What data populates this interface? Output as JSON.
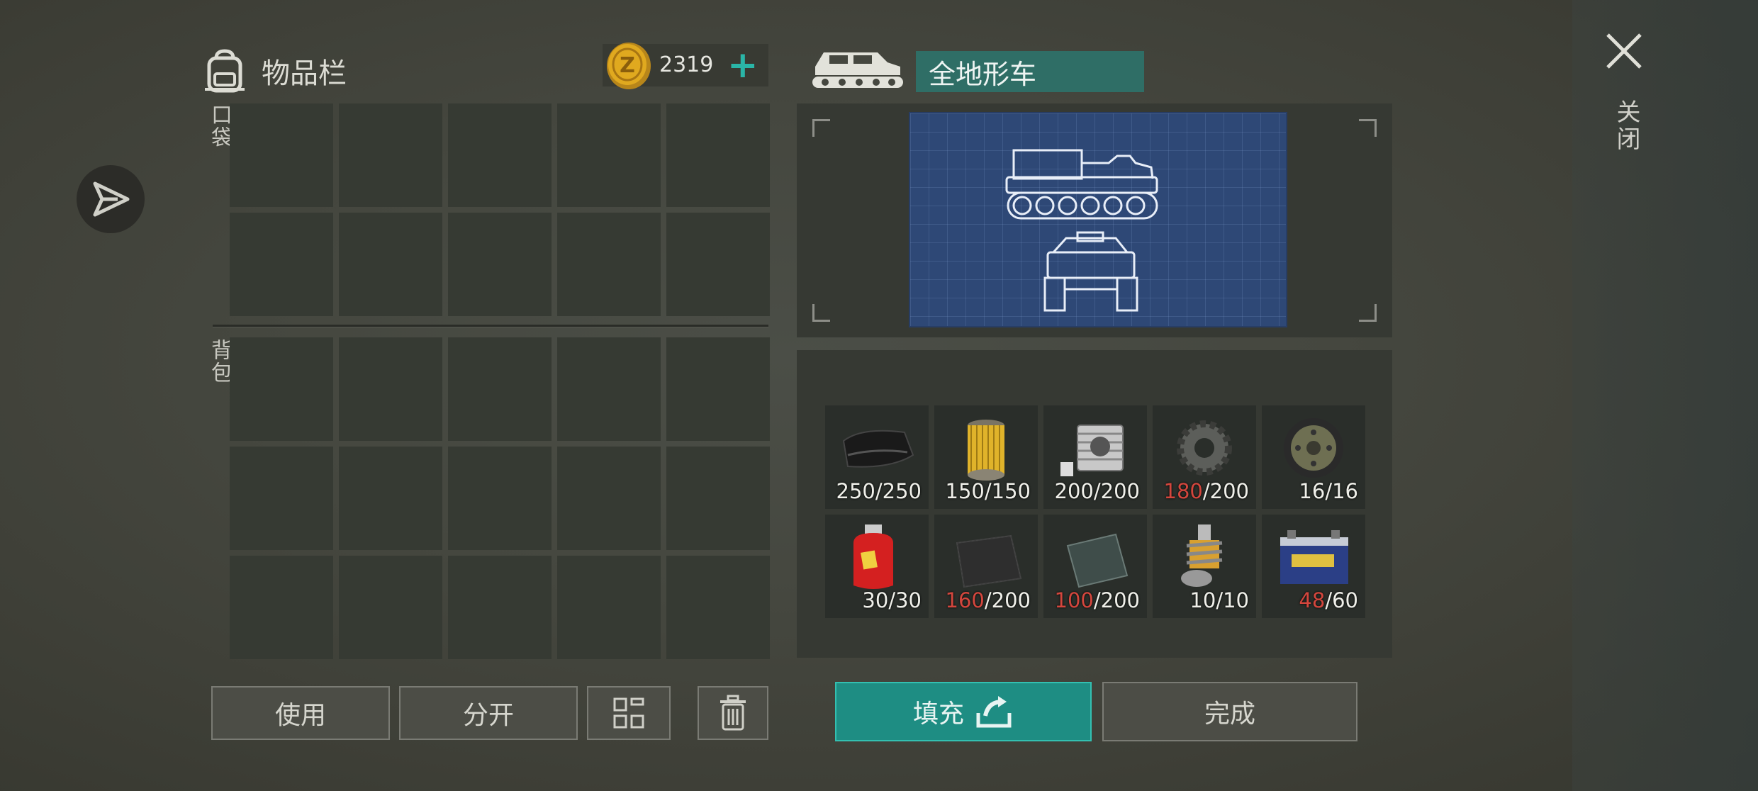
{
  "inventory": {
    "title": "物品栏",
    "coins": "2319",
    "pocket_label": "口袋",
    "backpack_label": "背包"
  },
  "buttons": {
    "use": "使用",
    "split": "分开",
    "fill": "填充",
    "done": "完成"
  },
  "vehicle": {
    "name": "全地形车"
  },
  "close": {
    "label": "关闭"
  },
  "materials": [
    {
      "name": "rubber-icon",
      "have": "250",
      "need": "250",
      "short": false
    },
    {
      "name": "oil-filter-icon",
      "have": "150",
      "need": "150",
      "short": false
    },
    {
      "name": "engine-cylinder-icon",
      "have": "200",
      "need": "200",
      "short": false
    },
    {
      "name": "gear-icon",
      "have": "180",
      "need": "200",
      "short": true
    },
    {
      "name": "wheel-rim-icon",
      "have": "16",
      "need": "16",
      "short": false
    },
    {
      "name": "gas-cylinder-icon",
      "have": "30",
      "need": "30",
      "short": false
    },
    {
      "name": "carbon-fiber-icon",
      "have": "160",
      "need": "200",
      "short": true
    },
    {
      "name": "metal-plate-icon",
      "have": "100",
      "need": "200",
      "short": true
    },
    {
      "name": "shock-absorber-icon",
      "have": "10",
      "need": "10",
      "short": false
    },
    {
      "name": "battery-icon",
      "have": "48",
      "need": "60",
      "short": true
    }
  ],
  "colors": {
    "accent_teal": "#2ab5a7",
    "shortage_red": "#d4463d",
    "coin_gold": "#e0a91f"
  }
}
